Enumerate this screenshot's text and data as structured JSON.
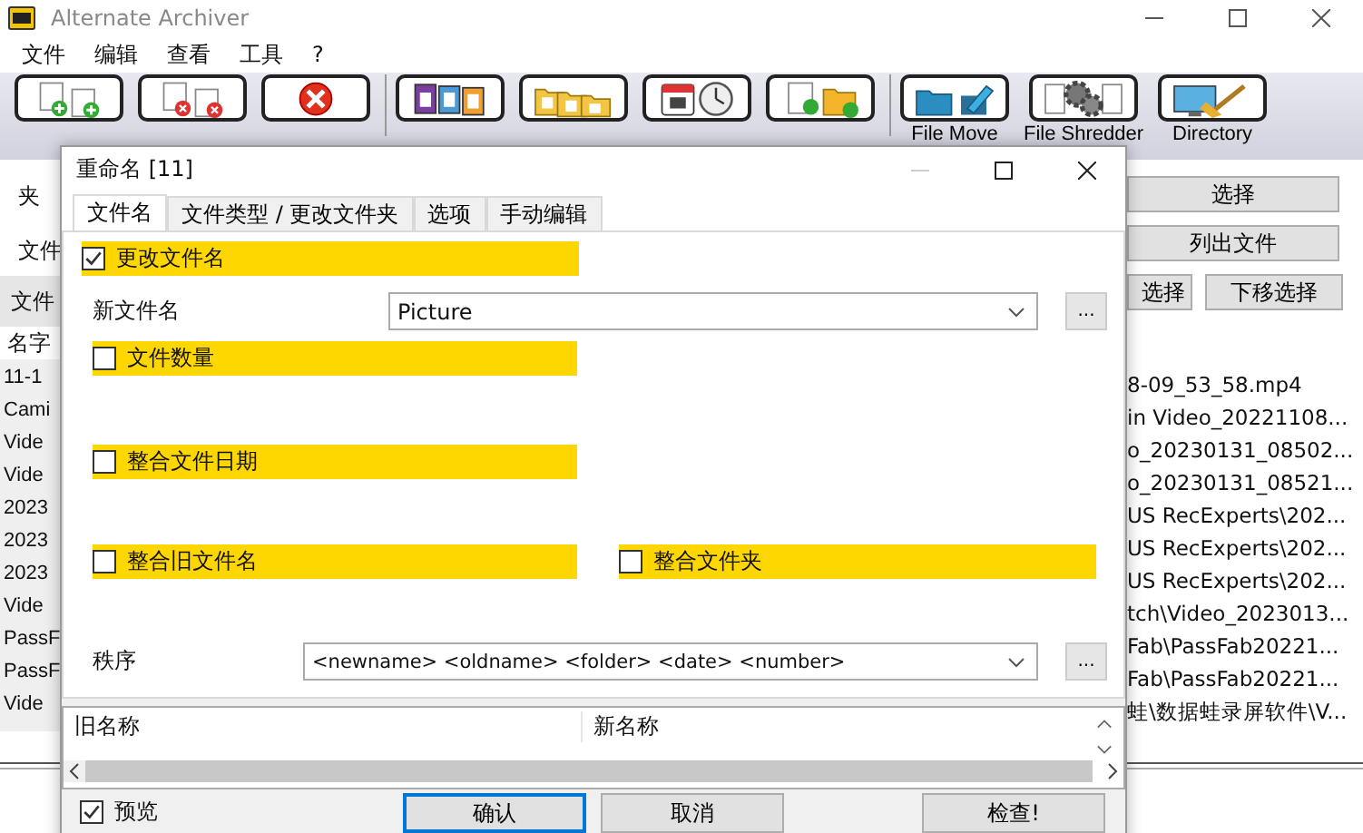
{
  "window": {
    "title": "Alternate Archiver"
  },
  "menu": [
    "文件",
    "编辑",
    "查看",
    "工具",
    "?"
  ],
  "toolbar": [
    {
      "kind": "add"
    },
    {
      "kind": "remove"
    },
    {
      "kind": "remove_all"
    },
    {
      "kind": "rename"
    },
    {
      "kind": "archive"
    },
    {
      "kind": "file_date"
    },
    {
      "kind": "relocate"
    },
    {
      "kind": "file_move",
      "label": "File Move"
    },
    {
      "kind": "file_shredder",
      "label": "File Shredder"
    },
    {
      "kind": "directory",
      "label": "Directory"
    }
  ],
  "main_left": {
    "labels": [
      "夹",
      "文件"
    ],
    "bar_label": "文件",
    "column": "名字",
    "rows": [
      "11-1",
      "Cami",
      "Vide",
      "Vide",
      "2023",
      "2023",
      "2023",
      "Vide",
      "PassF",
      "PassF",
      "Vide"
    ]
  },
  "main_right": {
    "buttons": [
      "选择",
      "列出文件"
    ],
    "move_buttons": [
      "选择",
      "下移选择"
    ],
    "rows": [
      "8-09_53_58.mp4",
      "in Video_20221108...",
      "o_20230131_08502...",
      "o_20230131_08521...",
      "US RecExperts\\202...",
      "US RecExperts\\202...",
      "US RecExperts\\202...",
      "tch\\Video_2023013...",
      "Fab\\PassFab20221...",
      "Fab\\PassFab20221...",
      "蛙\\数据蛙录屏软件\\V..."
    ]
  },
  "dialog": {
    "title": "重命名 [11]",
    "tabs": [
      {
        "label": "文件名",
        "selected": true
      },
      {
        "label": "文件类型 / 更改文件夹",
        "selected": false
      },
      {
        "label": "选项",
        "selected": false
      },
      {
        "label": "手动编辑",
        "selected": false
      }
    ],
    "change_name": {
      "label": "更改文件名",
      "checked": true
    },
    "new_name": {
      "label": "新文件名",
      "value": "Picture",
      "button": "..."
    },
    "file_count": {
      "label": "文件数量",
      "checked": false
    },
    "file_date": {
      "label": "整合文件日期",
      "checked": false
    },
    "old_name": {
      "label": "整合旧文件名",
      "checked": false
    },
    "folder": {
      "label": "整合文件夹",
      "checked": false
    },
    "order": {
      "label": "秩序",
      "value": "<newname> <oldname> <folder> <date> <number>",
      "button": "..."
    },
    "list_columns": [
      "旧名称",
      "新名称"
    ],
    "preview": {
      "label": "预览",
      "checked": true
    },
    "buttons": [
      "确认",
      "取消",
      "检查!"
    ]
  }
}
